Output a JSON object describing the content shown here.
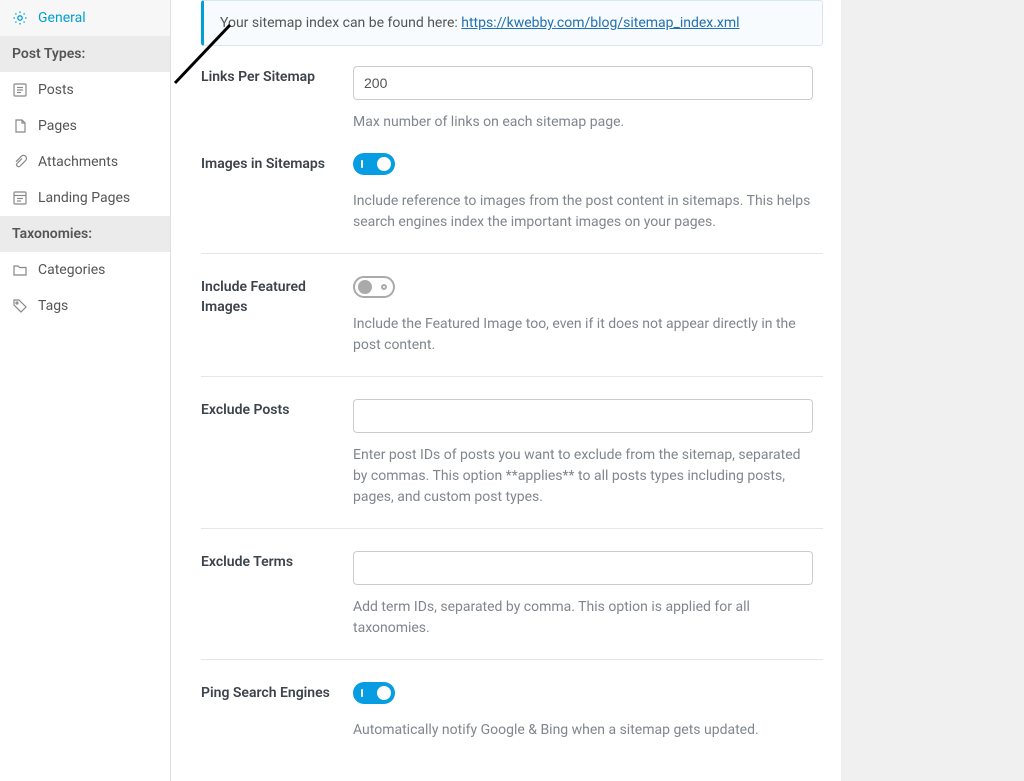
{
  "sidebar": {
    "general": "General",
    "post_types_header": "Post Types:",
    "items": [
      {
        "label": "Posts"
      },
      {
        "label": "Pages"
      },
      {
        "label": "Attachments"
      },
      {
        "label": "Landing Pages"
      }
    ],
    "taxonomies_header": "Taxonomies:",
    "tax_items": [
      {
        "label": "Categories"
      },
      {
        "label": "Tags"
      }
    ]
  },
  "notice": {
    "text": "Your sitemap index can be found here: ",
    "url": "https://kwebby.com/blog/sitemap_index.xml"
  },
  "fields": {
    "links_per_sitemap": {
      "label": "Links Per Sitemap",
      "value": "200",
      "desc": "Max number of links on each sitemap page."
    },
    "images_in_sitemaps": {
      "label": "Images in Sitemaps",
      "desc": "Include reference to images from the post content in sitemaps. This helps search engines index the important images on your pages."
    },
    "include_featured": {
      "label": "Include Featured Images",
      "desc": "Include the Featured Image too, even if it does not appear directly in the post content."
    },
    "exclude_posts": {
      "label": "Exclude Posts",
      "desc": "Enter post IDs of posts you want to exclude from the sitemap, separated by commas. This option **applies** to all posts types including posts, pages, and custom post types."
    },
    "exclude_terms": {
      "label": "Exclude Terms",
      "desc": "Add term IDs, separated by comma. This option is applied for all taxonomies."
    },
    "ping": {
      "label": "Ping Search Engines",
      "desc": "Automatically notify Google & Bing when a sitemap gets updated."
    }
  }
}
